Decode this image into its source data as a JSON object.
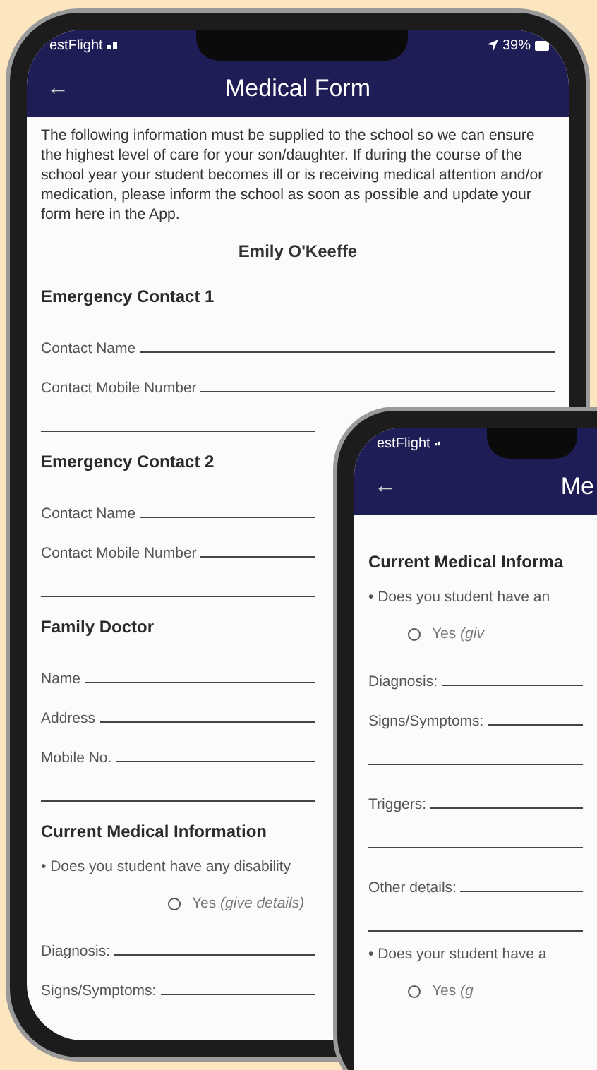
{
  "phone_back": {
    "status": {
      "carrier": "estFlight",
      "battery": "39%"
    },
    "header": {
      "back": "←",
      "title": "Medical Form"
    },
    "intro": "The following information must be supplied to the school so we can ensure the highest level of care for your son/daughter. If during the course of the school year your student becomes ill or is receiving medical attention and/or medication, please inform the school as soon as possible and update your form here in the App.",
    "student": "Emily O'Keeffe",
    "sections": [
      {
        "heading": "Emergency Contact 1",
        "items": [
          {
            "kind": "field",
            "label": "Contact Name"
          },
          {
            "kind": "field",
            "label": "Contact Mobile Number"
          },
          {
            "kind": "line"
          }
        ]
      },
      {
        "heading": "Emergency Contact 2",
        "items": [
          {
            "kind": "field",
            "label": "Contact Name"
          },
          {
            "kind": "field",
            "label": "Contact Mobile Number"
          },
          {
            "kind": "line"
          }
        ]
      },
      {
        "heading": "Family Doctor",
        "items": [
          {
            "kind": "field",
            "label": "Name"
          },
          {
            "kind": "field",
            "label": "Address"
          },
          {
            "kind": "field",
            "label": "Mobile No."
          },
          {
            "kind": "line"
          }
        ]
      },
      {
        "heading": "Current Medical Information",
        "items": [
          {
            "kind": "question",
            "text": "• Does you student have any disability"
          },
          {
            "kind": "option",
            "label": "Yes *(give details)*",
            "selected": false
          },
          {
            "kind": "field",
            "label": "Diagnosis:"
          },
          {
            "kind": "field",
            "label": "Signs/Symptoms:"
          }
        ]
      }
    ]
  },
  "phone_front": {
    "status": {
      "carrier": "estFlight"
    },
    "header": {
      "back": "←",
      "title": "Me"
    },
    "sections": [
      {
        "heading": "Current Medical Informa",
        "items": [
          {
            "kind": "question",
            "text": "• Does you student have an"
          },
          {
            "kind": "option",
            "label": "Yes *(giv*",
            "selected": false
          },
          {
            "kind": "field",
            "label": "Diagnosis:"
          },
          {
            "kind": "field",
            "label": "Signs/Symptoms:"
          },
          {
            "kind": "line"
          },
          {
            "kind": "field",
            "label": "Triggers:"
          },
          {
            "kind": "line"
          },
          {
            "kind": "field",
            "label": "Other details:"
          },
          {
            "kind": "line"
          },
          {
            "kind": "question",
            "text": "• Does your student have a"
          },
          {
            "kind": "option",
            "label": "Yes *(g*",
            "selected": false
          }
        ]
      }
    ]
  }
}
